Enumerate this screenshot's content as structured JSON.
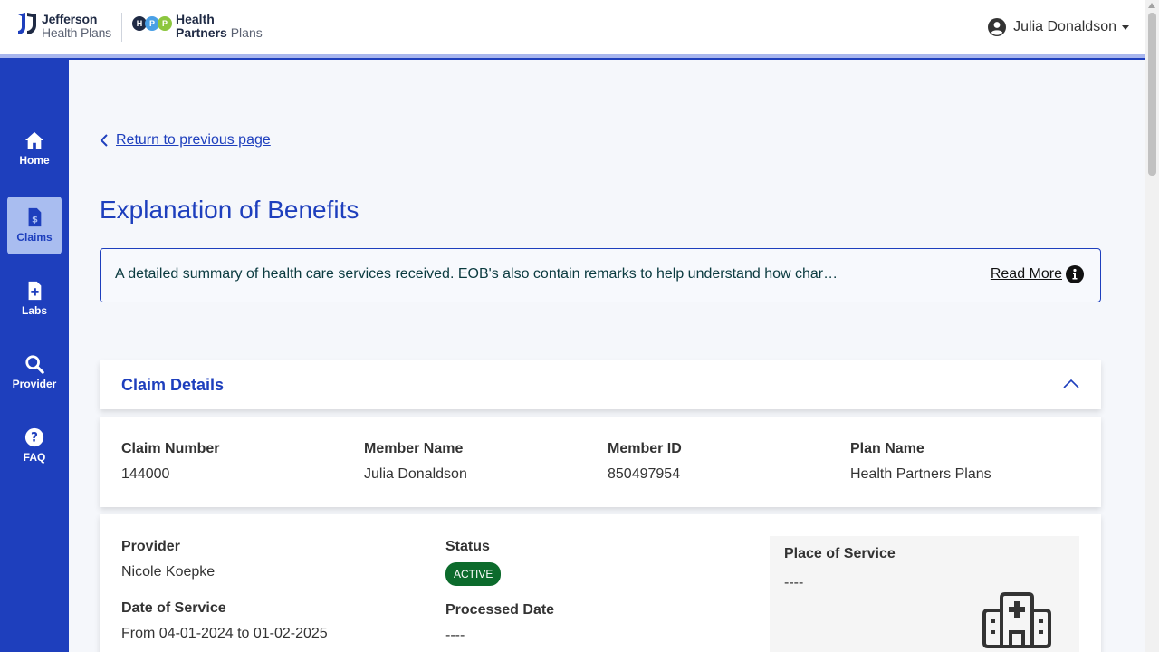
{
  "header": {
    "brand_primary_line1": "Jefferson",
    "brand_primary_line2": "Health Plans",
    "brand_secondary_line1": "Health",
    "brand_secondary_line2a": "Partners",
    "brand_secondary_line2b": "Plans",
    "brand_circles": [
      "H",
      "P",
      "P"
    ],
    "user_name": "Julia Donaldson"
  },
  "sidebar": {
    "items": [
      {
        "label": "Home",
        "icon": "home-icon",
        "active": false
      },
      {
        "label": "Claims",
        "icon": "claims-icon",
        "active": true
      },
      {
        "label": "Labs",
        "icon": "labs-icon",
        "active": false
      },
      {
        "label": "Provider",
        "icon": "search-icon",
        "active": false
      },
      {
        "label": "FAQ",
        "icon": "faq-icon",
        "active": false
      }
    ]
  },
  "main": {
    "back_link": "Return to previous page",
    "title": "Explanation of Benefits",
    "info": {
      "description": "A detailed summary of health care services received. EOB's also contain remarks to help understand how char…",
      "read_more": "Read More"
    },
    "claim_details": {
      "title": "Claim Details",
      "summary": [
        {
          "label": "Claim Number",
          "value": "144000"
        },
        {
          "label": "Member Name",
          "value": "Julia Donaldson"
        },
        {
          "label": "Member ID",
          "value": "850497954"
        },
        {
          "label": "Plan Name",
          "value": "Health Partners Plans"
        }
      ],
      "provider_label": "Provider",
      "provider_value": "Nicole Koepke",
      "date_label": "Date of Service",
      "date_value": "From 04-01-2024 to 01-02-2025",
      "status_label": "Status",
      "status_value": "ACTIVE",
      "processed_label": "Processed Date",
      "processed_value": "----",
      "place_label": "Place of Service",
      "place_value": "----"
    }
  },
  "colors": {
    "brand_blue": "#1e3fbd",
    "active_nav_bg": "#a9bdf0",
    "status_active": "#0c6b2c"
  }
}
